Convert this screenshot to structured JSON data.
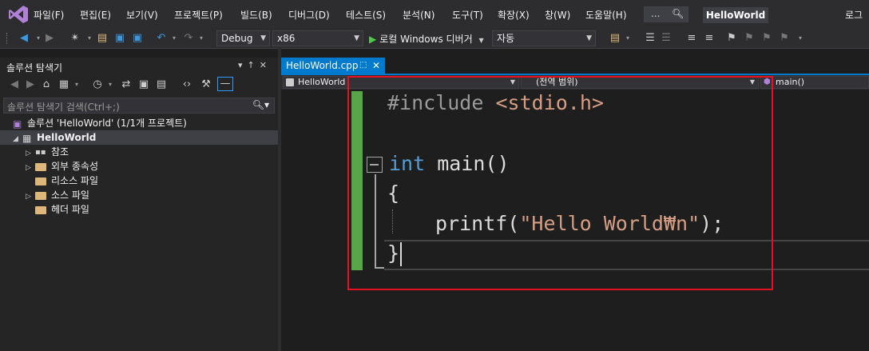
{
  "menubar": {
    "items": [
      "파일(F)",
      "편집(E)",
      "보기(V)",
      "프로젝트(P)",
      "빌드(B)",
      "디버그(D)",
      "테스트(S)",
      "분석(N)",
      "도구(T)",
      "확장(X)",
      "창(W)",
      "도움말(H)"
    ],
    "quick_search": "...",
    "project_title": "HelloWorld",
    "account": "로그"
  },
  "toolbar": {
    "config": "Debug",
    "platform": "x86",
    "run_label": "로컬 Windows 디버거",
    "run_dropdown": "자동"
  },
  "solution_explorer": {
    "title": "솔루션 탐색기",
    "search_placeholder": "솔루션 탐색기 검색(Ctrl+;)",
    "solution": "솔루션 'HelloWorld' (1/1개 프로젝트)",
    "project": "HelloWorld",
    "items": [
      "참조",
      "외부 종속성",
      "리소스 파일",
      "소스 파일",
      "헤더 파일"
    ]
  },
  "editor": {
    "tab_name": "HelloWorld.cpp",
    "nav_project": "HelloWorld",
    "nav_scope": "(전역 범위)",
    "nav_member": "main()",
    "code": {
      "line1_directive": "#include",
      "line1_header": "<stdio.h>",
      "line3_kw": "int",
      "line3_rest": " main()",
      "line4": "{",
      "line5_fn": "printf(",
      "line5_str": "\"Hello World₩n\"",
      "line5_end": ");",
      "line6": "}"
    }
  },
  "colors": {
    "keyword": "#569cd6",
    "string": "#d69d85",
    "accent": "#007acc",
    "highlight_box": "#e81123",
    "change_margin": "#57a64a"
  }
}
